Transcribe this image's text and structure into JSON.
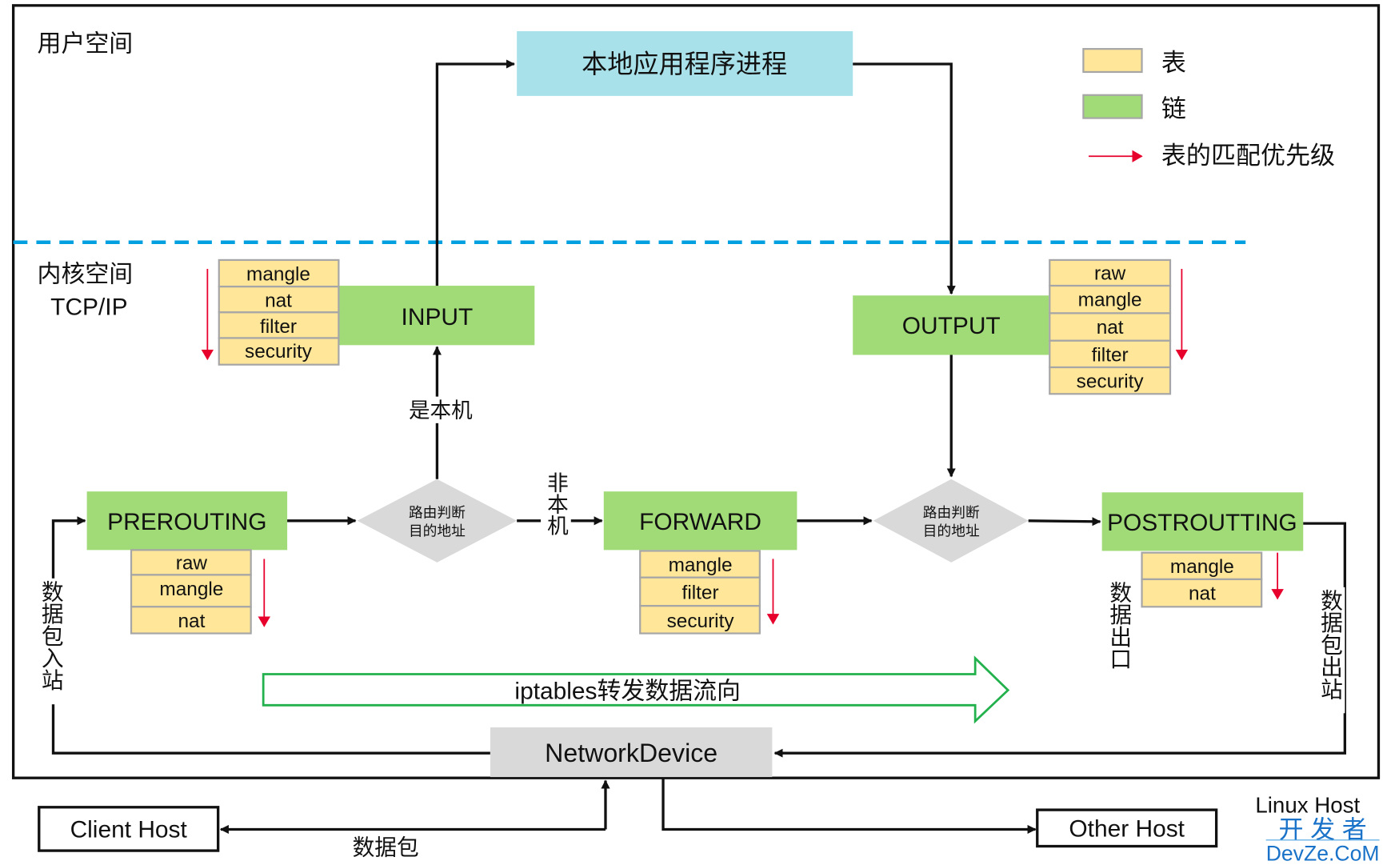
{
  "labels": {
    "user_space": "用户空间",
    "kernel_space": "内核空间",
    "tcpip": "TCP/IP",
    "local_process": "本地应用程序进程",
    "is_local": "是本机",
    "not_local": "非本机",
    "route_decision_1": "路由判断",
    "route_decision_2": "目的地址",
    "packet_in": "数据包入站",
    "packet_out": "数据包出站",
    "data_exit": "数据出口",
    "flow": "iptables转发数据流向",
    "network_device": "NetworkDevice",
    "client_host": "Client Host",
    "other_host": "Other Host",
    "linux_host": "Linux Host",
    "packet": "数据包"
  },
  "legend": {
    "table": "表",
    "chain": "链",
    "priority": "表的匹配优先级",
    "table_color": "#ffe699",
    "chain_color": "#a0db78",
    "arrow_color": "#e8002d"
  },
  "chains": {
    "input": {
      "name": "INPUT",
      "tables": [
        "mangle",
        "nat",
        "filter",
        "security"
      ]
    },
    "output": {
      "name": "OUTPUT",
      "tables": [
        "raw",
        "mangle",
        "nat",
        "filter",
        "security"
      ]
    },
    "prerouting": {
      "name": "PREROUTING",
      "tables": [
        "raw",
        "mangle",
        "nat"
      ]
    },
    "forward": {
      "name": "FORWARD",
      "tables": [
        "mangle",
        "filter",
        "security"
      ]
    },
    "postrouting": {
      "name": "POSTROUTTING",
      "tables": [
        "mangle",
        "nat"
      ]
    }
  },
  "watermark": {
    "line1": "开 发 者",
    "line2": "DevZe.CoM"
  }
}
